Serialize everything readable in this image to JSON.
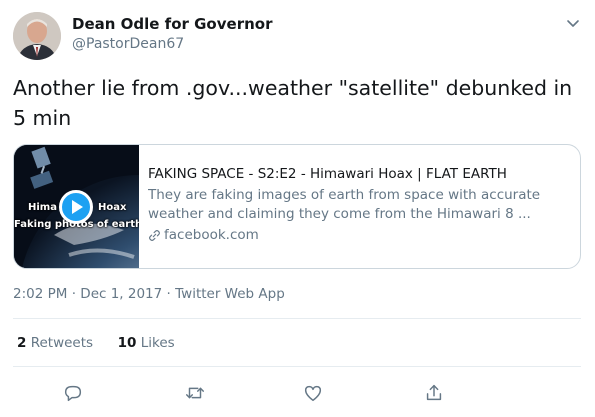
{
  "user": {
    "display_name": "Dean Odle for Governor",
    "handle": "@PastorDean67",
    "avatar_icon": "profile-photo"
  },
  "tweet": {
    "text": "Another lie from .gov...weather \"satellite\" debunked in 5 min"
  },
  "card": {
    "title": "FAKING SPACE - S2:E2 - Himawari Hoax | FLAT EARTH",
    "description": "They are faking images of earth from space with accurate weather and claiming they come from the Himawari 8 ...",
    "domain": "facebook.com",
    "thumb_caption_left": "Hima",
    "thumb_caption_right": "Hoax",
    "thumb_caption_line2": "Faking photos of earth"
  },
  "meta": {
    "time": "2:02 PM",
    "date": "Dec 1, 2017",
    "source": "Twitter Web App",
    "sep": "·"
  },
  "stats": {
    "retweets_count": "2",
    "retweets_label": "Retweets",
    "likes_count": "10",
    "likes_label": "Likes"
  },
  "colors": {
    "text": "#14171a",
    "secondary": "#657786",
    "border": "#ccd6dd",
    "divider": "#e6ecf0",
    "play": "#1da1f2"
  },
  "icons": {
    "reply": "reply-icon",
    "retweet": "retweet-icon",
    "like": "heart-icon",
    "share": "share-icon",
    "caret": "chevron-down-icon",
    "link": "link-icon"
  }
}
